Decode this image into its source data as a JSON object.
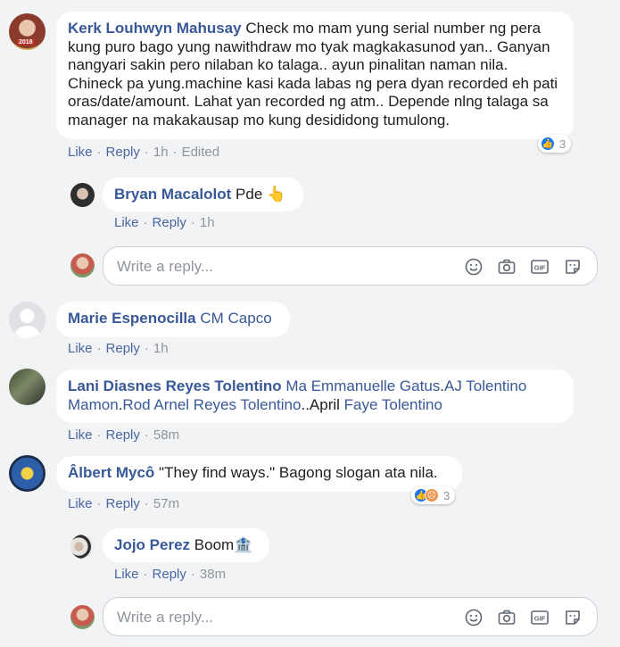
{
  "comments": [
    {
      "author": "Kerk Louhwyn Mahusay",
      "text": "Check mo mam yung serial number ng pera kung puro bago yung nawithdraw mo tyak magkakasunod yan.. Ganyan nangyari sakin pero nilaban ko talaga.. ayun pinalitan naman nila. Chineck pa yung.machine kasi kada labas ng pera dyan recorded eh pati oras/date/amount. Lahat yan recorded ng atm.. Depende nlng talaga sa manager na makakausap mo kung desididong tumulong.",
      "like": "Like",
      "reply": "Reply",
      "time": "1h",
      "edited": "Edited",
      "reaction_count": "3",
      "avatar_badge": "2018",
      "replies": [
        {
          "author": "Bryan Macalolot",
          "text": "Pde",
          "emoji": "👆",
          "like": "Like",
          "reply": "Reply",
          "time": "1h"
        }
      ]
    },
    {
      "author": "Marie Espenocilla",
      "tag": "CM Capco",
      "like": "Like",
      "reply": "Reply",
      "time": "1h"
    },
    {
      "author": "Lani Diasnes Reyes Tolentino",
      "tags": [
        "Ma Emmanuelle Gatus",
        "AJ Tolentino Mamon",
        "Rod Arnel Reyes Tolentino",
        "Faye Tolentino"
      ],
      "separators": [
        ".",
        ".",
        "..April "
      ],
      "like": "Like",
      "reply": "Reply",
      "time": "58m"
    },
    {
      "author": "Âlbert Mycô",
      "text": "\"They find ways.\" Bagong slogan ata nila.",
      "like": "Like",
      "reply": "Reply",
      "time": "57m",
      "reaction_count": "3",
      "replies": [
        {
          "author": "Jojo Perez",
          "text": "Boom",
          "emoji": "🏦",
          "like": "Like",
          "reply": "Reply",
          "time": "38m"
        }
      ]
    }
  ],
  "reply_box": {
    "placeholder": "Write a reply..."
  },
  "icons": [
    "emoji-icon",
    "camera-icon",
    "gif-icon",
    "sticker-icon",
    "like-reaction-icon",
    "angry-reaction-icon"
  ],
  "colors": {
    "author": "#385898",
    "link": "#4b67a1",
    "meta": "#90949c",
    "background": "#f2f3f5",
    "like": "#1877f2"
  }
}
